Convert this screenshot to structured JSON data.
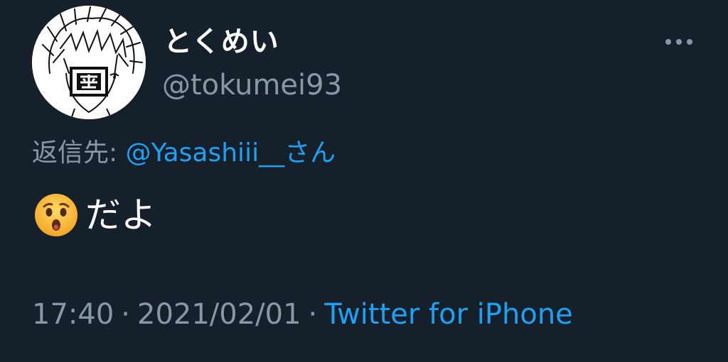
{
  "user": {
    "display_name": "とくめい",
    "handle": "@tokumei93"
  },
  "reply": {
    "prefix": "返信先: ",
    "mention": "@Yasashiii__さん"
  },
  "tweet": {
    "emoji": "hushed-face-emoji",
    "text": "だよ"
  },
  "meta": {
    "time": "17:40",
    "separator": "·",
    "date": "2021/02/01",
    "source": "Twitter for iPhone"
  },
  "colors": {
    "background": "#15202b",
    "secondary_text": "#8899a6",
    "link": "#1da1f2",
    "primary_text": "#ffffff"
  }
}
